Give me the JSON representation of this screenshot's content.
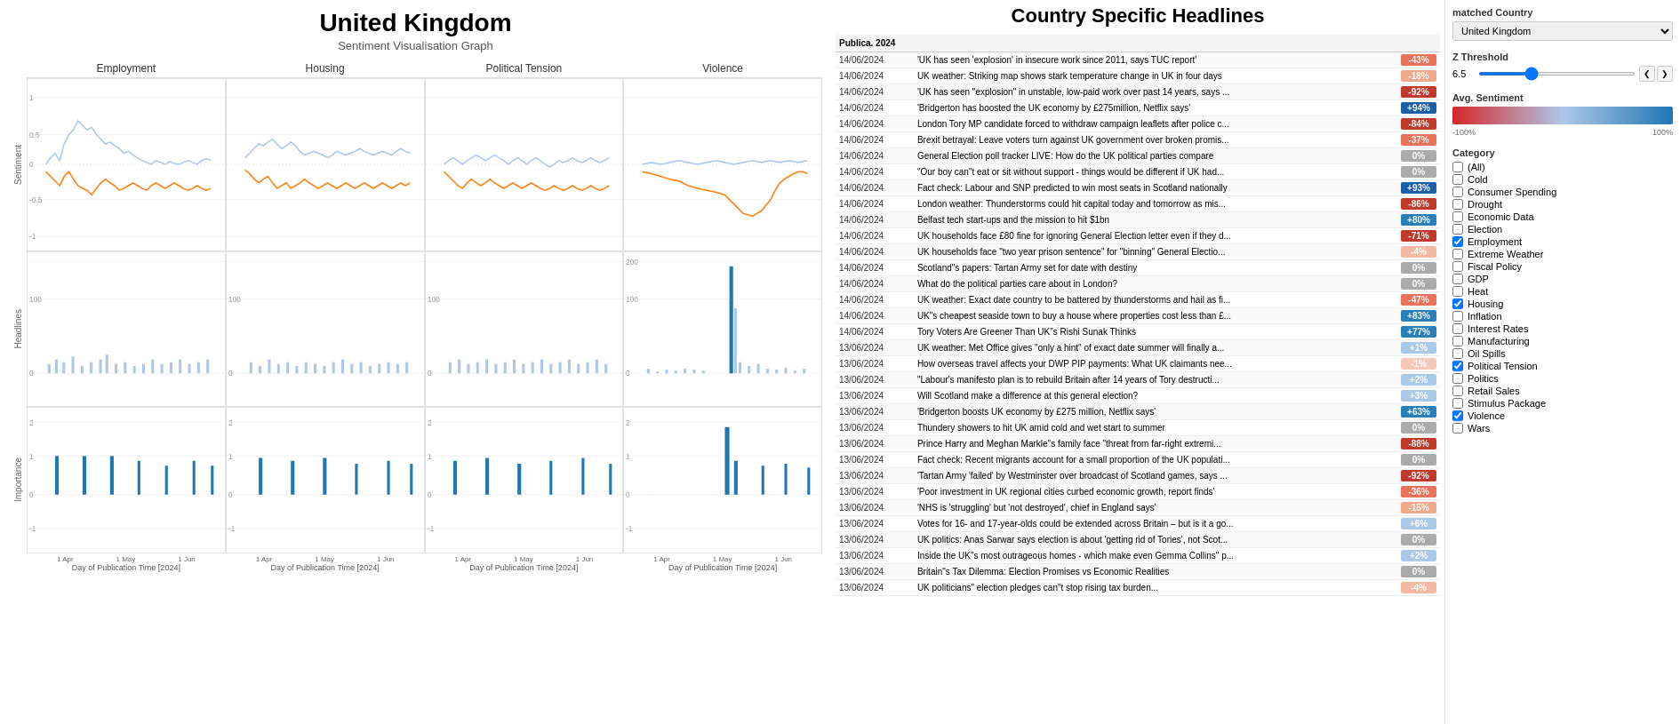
{
  "page": {
    "title": "United Kingdom",
    "subtitle": "Sentiment Visualisation Graph"
  },
  "columns": [
    "Employment",
    "Housing",
    "Political Tension",
    "Violence"
  ],
  "row_labels": [
    "Sentiment",
    "Headlines",
    "Importance"
  ],
  "y_axis_labels": {
    "sentiment": [
      "1.0",
      "0.5",
      "0",
      "-0.5",
      "-1.0"
    ],
    "headlines": [
      "200",
      "100",
      "0"
    ],
    "importance": [
      "2",
      "1",
      "0",
      "-1"
    ]
  },
  "x_axis_label": "Day of Publication Time [2024]",
  "x_ticks": [
    "1 Apr",
    "1 May",
    "1 Jun"
  ],
  "headlines_title": "Country Specific Headlines",
  "table_headers": {
    "publication": "Publica. 2024",
    "headline": "",
    "sentiment": ""
  },
  "headlines": [
    {
      "date": "14/06/2024",
      "text": "'UK has seen 'explosion' in insecure work since 2011, says TUC report'",
      "sentiment": -43,
      "color": "#e8735a"
    },
    {
      "date": "14/06/2024",
      "text": "UK weather: Striking map shows stark temperature change in UK in four days",
      "sentiment": -18,
      "color": "#f0a98a"
    },
    {
      "date": "14/06/2024",
      "text": "'UK has seen \"explosion\" in unstable, low-paid work over past 14 years, says ...",
      "sentiment": -92,
      "color": "#c0392b"
    },
    {
      "date": "14/06/2024",
      "text": "'Bridgerton has boosted the UK economy by £275million, Netflix says'",
      "sentiment": 94,
      "color": "#1a5fa8"
    },
    {
      "date": "14/06/2024",
      "text": "London Tory MP candidate forced to withdraw campaign leaflets after police c...",
      "sentiment": -84,
      "color": "#c0392b"
    },
    {
      "date": "14/06/2024",
      "text": "Brexit betrayal: Leave voters turn against UK government over broken promis...",
      "sentiment": -37,
      "color": "#e8735a"
    },
    {
      "date": "14/06/2024",
      "text": "General Election poll tracker LIVE: How do the UK political parties compare",
      "sentiment": 0,
      "color": "#aaaaaa"
    },
    {
      "date": "14/06/2024",
      "text": "\"Our boy can\"t eat or sit without support - things would be different if UK had...",
      "sentiment": 0,
      "color": "#aaaaaa"
    },
    {
      "date": "14/06/2024",
      "text": "Fact check: Labour and SNP predicted to win most seats in Scotland nationally",
      "sentiment": 93,
      "color": "#1a5fa8"
    },
    {
      "date": "14/06/2024",
      "text": "London weather: Thunderstorms could hit capital today and tomorrow as mis...",
      "sentiment": -86,
      "color": "#c0392b"
    },
    {
      "date": "14/06/2024",
      "text": "Belfast tech start-ups and the mission to hit $1bn",
      "sentiment": 80,
      "color": "#2980b9"
    },
    {
      "date": "14/06/2024",
      "text": "UK households face £80 fine for ignoring General Election letter even if they d...",
      "sentiment": -71,
      "color": "#c0392b"
    },
    {
      "date": "14/06/2024",
      "text": "UK households face \"two year prison sentence\" for \"binning\" General Electio...",
      "sentiment": -4,
      "color": "#f5b8a0"
    },
    {
      "date": "14/06/2024",
      "text": "Scotland\"s papers: Tartan Army set for date with destiny",
      "sentiment": 0,
      "color": "#aaaaaa"
    },
    {
      "date": "14/06/2024",
      "text": "What do the political parties care about in London?",
      "sentiment": 0,
      "color": "#aaaaaa"
    },
    {
      "date": "14/06/2024",
      "text": "UK weather: Exact date country to be battered by thunderstorms and hail as fi...",
      "sentiment": -47,
      "color": "#e8735a"
    },
    {
      "date": "14/06/2024",
      "text": "UK\"s cheapest seaside town to buy a house where properties cost less than £...",
      "sentiment": 83,
      "color": "#2980b9"
    },
    {
      "date": "14/06/2024",
      "text": "Tory Voters Are Greener Than UK\"s Rishi Sunak Thinks",
      "sentiment": 77,
      "color": "#2980b9"
    },
    {
      "date": "13/06/2024",
      "text": "UK weather: Met Office gives \"only a hint\" of exact date summer will finally a...",
      "sentiment": 1,
      "color": "#aac8e8"
    },
    {
      "date": "13/06/2024",
      "text": "How overseas travel affects your DWP PIP payments: What UK claimants nee...",
      "sentiment": -1,
      "color": "#f5c8b8"
    },
    {
      "date": "13/06/2024",
      "text": "\"Labour's manifesto plan is to rebuild Britain after 14 years of Tory destructi...",
      "sentiment": 2,
      "color": "#aac8e8"
    },
    {
      "date": "13/06/2024",
      "text": "Will Scotland make a difference at this general election?",
      "sentiment": 3,
      "color": "#aac8e8"
    },
    {
      "date": "13/06/2024",
      "text": "'Bridgerton boosts UK economy by £275 million, Netflix says'",
      "sentiment": 63,
      "color": "#2980b9"
    },
    {
      "date": "13/06/2024",
      "text": "Thundery showers to hit UK amid cold and wet start to summer",
      "sentiment": 0,
      "color": "#aaaaaa"
    },
    {
      "date": "13/06/2024",
      "text": "Prince Harry and Meghan Markle\"s family face \"threat from far-right extremi...",
      "sentiment": -88,
      "color": "#c0392b"
    },
    {
      "date": "13/06/2024",
      "text": "Fact check: Recent migrants account for a small proportion of the UK populati...",
      "sentiment": 0,
      "color": "#aaaaaa"
    },
    {
      "date": "13/06/2024",
      "text": "'Tartan Army 'failed' by Westminster over broadcast of Scotland games, says ...",
      "sentiment": -92,
      "color": "#c0392b"
    },
    {
      "date": "13/06/2024",
      "text": "'Poor investment in UK regional cities curbed economic growth, report finds'",
      "sentiment": -36,
      "color": "#e8735a"
    },
    {
      "date": "13/06/2024",
      "text": "'NHS is 'struggling' but 'not destroyed', chief in England says'",
      "sentiment": -15,
      "color": "#f0a98a"
    },
    {
      "date": "13/06/2024",
      "text": "Votes for 16- and 17-year-olds could be extended across Britain – but is it a go...",
      "sentiment": 6,
      "color": "#aac8e8"
    },
    {
      "date": "13/06/2024",
      "text": "UK politics: Anas Sarwar says election is about 'getting rid of Tories', not Scot...",
      "sentiment": 0,
      "color": "#aaaaaa"
    },
    {
      "date": "13/06/2024",
      "text": "Inside the UK\"s most outrageous homes - which make even Gemma Collins\" p...",
      "sentiment": 2,
      "color": "#aac8e8"
    },
    {
      "date": "13/06/2024",
      "text": "Britain\"s Tax Dilemma: Election Promises vs Economic Realities",
      "sentiment": 0,
      "color": "#aaaaaa"
    },
    {
      "date": "13/06/2024",
      "text": "UK politicians\" election pledges can\"t stop rising tax burden...",
      "sentiment": -4,
      "color": "#f5b8a0"
    }
  ],
  "controls": {
    "matched_country_label": "matched Country",
    "matched_country_value": "United Kingdom",
    "z_threshold_label": "Z Threshold",
    "z_threshold_value": "6.5",
    "avg_sentiment_label": "Avg. Sentiment",
    "sentiment_min_label": "-100%",
    "sentiment_max_label": "100%",
    "category_label": "Category",
    "categories": [
      {
        "label": "(All)",
        "checked": false
      },
      {
        "label": "Cold",
        "checked": false
      },
      {
        "label": "Consumer Spending",
        "checked": false
      },
      {
        "label": "Drought",
        "checked": false
      },
      {
        "label": "Economic Data",
        "checked": false
      },
      {
        "label": "Election",
        "checked": false
      },
      {
        "label": "Employment",
        "checked": true
      },
      {
        "label": "Extreme Weather",
        "checked": false
      },
      {
        "label": "Fiscal Policy",
        "checked": false
      },
      {
        "label": "GDP",
        "checked": false
      },
      {
        "label": "Heat",
        "checked": false
      },
      {
        "label": "Housing",
        "checked": true
      },
      {
        "label": "Inflation",
        "checked": false
      },
      {
        "label": "Interest Rates",
        "checked": false
      },
      {
        "label": "Manufacturing",
        "checked": false
      },
      {
        "label": "Oil Spills",
        "checked": false
      },
      {
        "label": "Political Tension",
        "checked": true
      },
      {
        "label": "Politics",
        "checked": false
      },
      {
        "label": "Retail Sales",
        "checked": false
      },
      {
        "label": "Stimulus Package",
        "checked": false
      },
      {
        "label": "Violence",
        "checked": true
      },
      {
        "label": "Wars",
        "checked": false
      }
    ]
  }
}
